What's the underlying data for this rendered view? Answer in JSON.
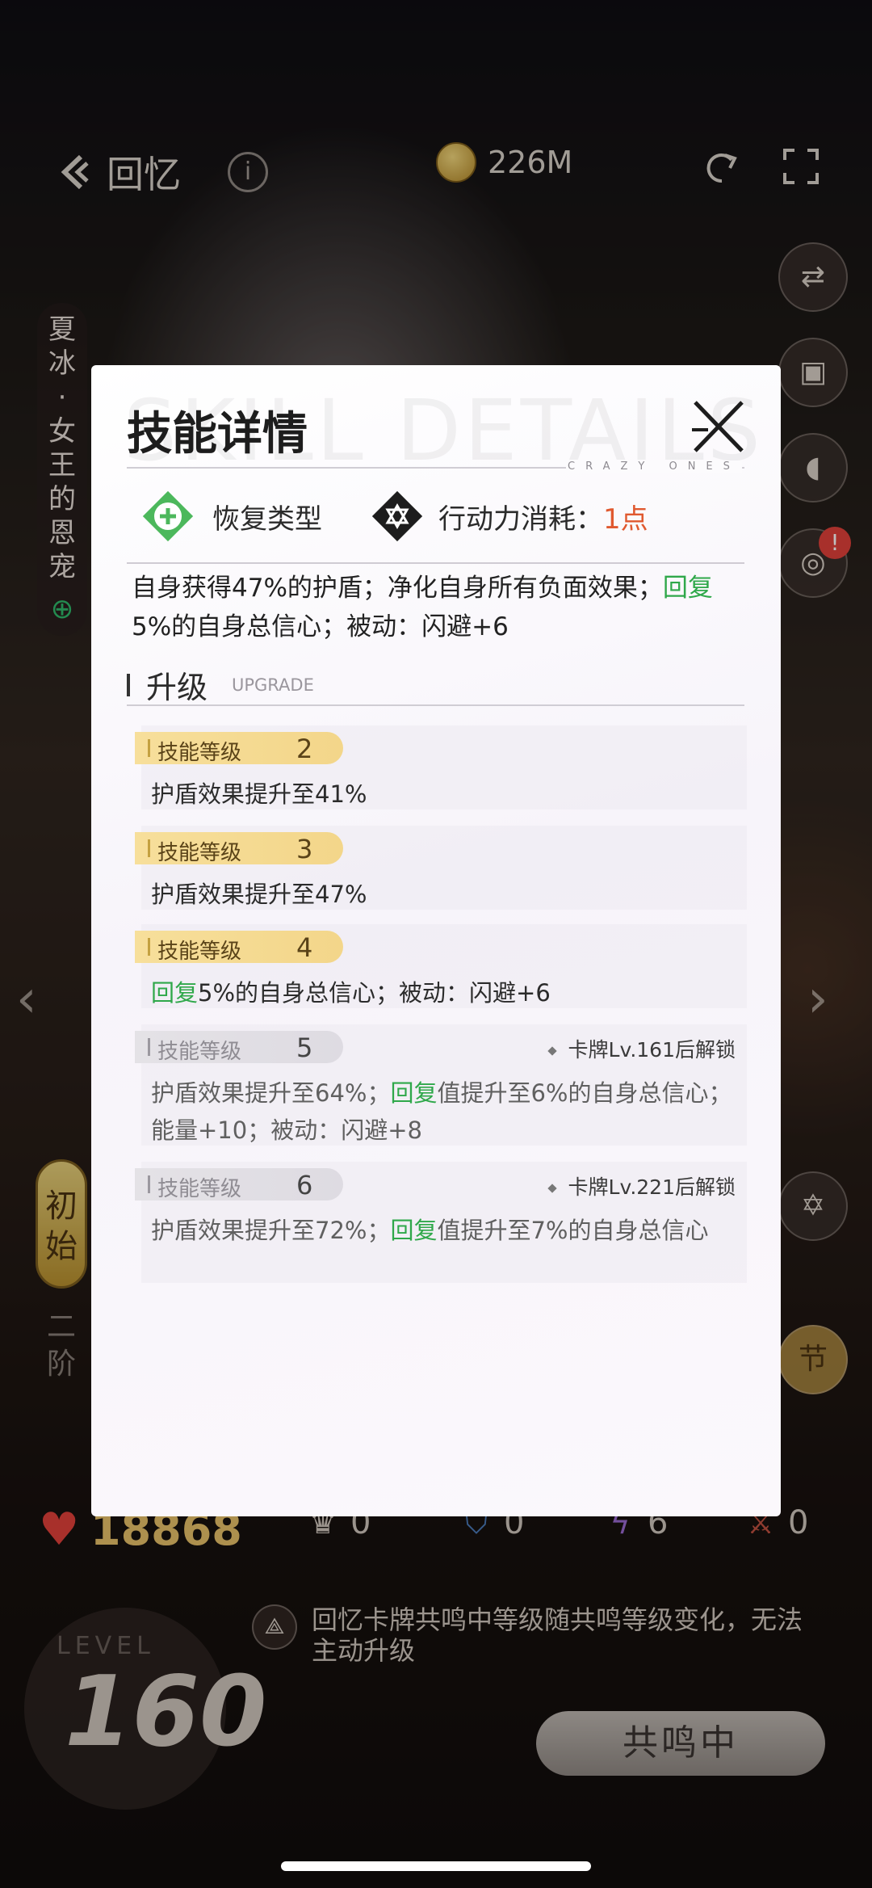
{
  "header": {
    "back_label": "回忆",
    "coins": "226M"
  },
  "card": {
    "vertical_title": "夏冰·女王的恩宠",
    "rank_current": "初始",
    "rank_next": "二阶",
    "level_label": "LEVEL",
    "level": "160"
  },
  "stats": {
    "hp": "18868",
    "crown": "0",
    "shield": "0",
    "energy": "6",
    "sword": "0"
  },
  "resonance": {
    "note": "回忆卡牌共鸣中等级随共鸣等级变化，无法主动升级",
    "button_label": "共鸣中"
  },
  "side_buttons": [
    "swap-icon",
    "lock-icon",
    "mic-icon",
    "film-icon",
    "star-icon"
  ],
  "alert_badge": "!",
  "stage_button": "节",
  "modal": {
    "title": "技能详情",
    "bg_title": "SKILL DETAILS",
    "brand": "CRAZY ONES",
    "skill_type": "恢复类型",
    "ap_cost_label": "行动力消耗：",
    "ap_cost_value": "1点",
    "description_main": "自身获得47%的护盾；净化自身所有负面效果；",
    "description_heal": "回复",
    "description_rest": "5%的自身总信心；被动：闪避+6",
    "upgrade_title": "升级",
    "upgrade_sub": "UPGRADE",
    "levels": [
      {
        "label": "技能等级",
        "level": "2",
        "unlock": "",
        "heal": "",
        "text": "护盾效果提升至41%",
        "text_after": "",
        "locked": false
      },
      {
        "label": "技能等级",
        "level": "3",
        "unlock": "",
        "heal": "",
        "text": "护盾效果提升至47%",
        "text_after": "",
        "locked": false
      },
      {
        "label": "技能等级",
        "level": "4",
        "unlock": "",
        "heal": "回复",
        "text": "",
        "text_after": "5%的自身总信心；被动：闪避+6",
        "locked": false
      },
      {
        "label": "技能等级",
        "level": "5",
        "unlock": "卡牌Lv.161后解锁",
        "heal": "回复",
        "text": "护盾效果提升至64%；",
        "text_after": "值提升至6%的自身总信心；能量+10；被动：闪避+8",
        "locked": true
      },
      {
        "label": "技能等级",
        "level": "6",
        "unlock": "卡牌Lv.221后解锁",
        "heal": "回复",
        "text": "护盾效果提升至72%；",
        "text_after": "值提升至7%的自身总信心",
        "locked": true
      }
    ]
  },
  "colors": {
    "heal_green": "#2fa84a",
    "cost_orange": "#e0592f",
    "badge_gold": "#f3d68a"
  }
}
